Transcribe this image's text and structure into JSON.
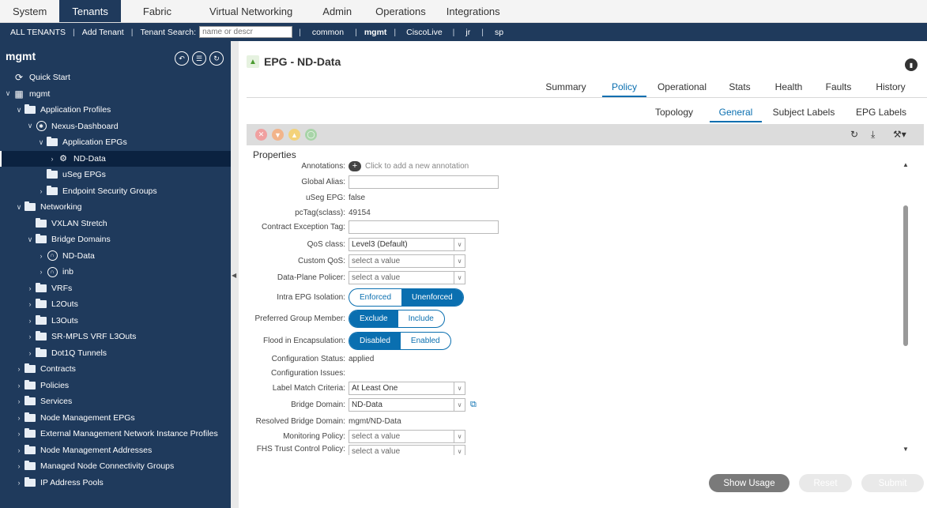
{
  "topnav": {
    "tabs": [
      {
        "label": "System"
      },
      {
        "label": "Tenants"
      },
      {
        "label": "Fabric"
      },
      {
        "label": "Virtual Networking"
      },
      {
        "label": "Admin"
      },
      {
        "label": "Operations"
      },
      {
        "label": "Integrations"
      }
    ],
    "active_tab": "Tenants"
  },
  "subnav": {
    "all_tenants": "ALL TENANTS",
    "add_tenant": "Add Tenant",
    "search_label": "Tenant Search:",
    "search_placeholder": "name or descr",
    "tenants": [
      "common",
      "mgmt",
      "CiscoLive",
      "jr",
      "sp"
    ]
  },
  "sidebar": {
    "title": "mgmt",
    "tree": [
      {
        "label": "Quick Start"
      },
      {
        "label": "mgmt"
      },
      {
        "label": "Application Profiles"
      },
      {
        "label": "Nexus-Dashboard"
      },
      {
        "label": "Application EPGs"
      },
      {
        "label": "ND-Data"
      },
      {
        "label": "uSeg EPGs"
      },
      {
        "label": "Endpoint Security Groups"
      },
      {
        "label": "Networking"
      },
      {
        "label": "VXLAN Stretch"
      },
      {
        "label": "Bridge Domains"
      },
      {
        "label": "ND-Data"
      },
      {
        "label": "inb"
      },
      {
        "label": "VRFs"
      },
      {
        "label": "L2Outs"
      },
      {
        "label": "L3Outs"
      },
      {
        "label": "SR-MPLS VRF L3Outs"
      },
      {
        "label": "Dot1Q Tunnels"
      },
      {
        "label": "Contracts"
      },
      {
        "label": "Policies"
      },
      {
        "label": "Services"
      },
      {
        "label": "Node Management EPGs"
      },
      {
        "label": "External Management Network Instance Profiles"
      },
      {
        "label": "Node Management Addresses"
      },
      {
        "label": "Managed Node Connectivity Groups"
      },
      {
        "label": "IP Address Pools"
      }
    ]
  },
  "main": {
    "title": "EPG - ND-Data",
    "tabs": [
      {
        "label": "Summary"
      },
      {
        "label": "Policy"
      },
      {
        "label": "Operational"
      },
      {
        "label": "Stats"
      },
      {
        "label": "Health"
      },
      {
        "label": "Faults"
      },
      {
        "label": "History"
      }
    ],
    "subtabs": [
      {
        "label": "Topology"
      },
      {
        "label": "General"
      },
      {
        "label": "Subject Labels"
      },
      {
        "label": "EPG Labels"
      }
    ],
    "properties_title": "Properties",
    "form": {
      "annotations_label": "Annotations:",
      "annotations_hint": "Click to add a new annotation",
      "global_alias_label": "Global Alias:",
      "useg_label": "uSeg EPG:",
      "useg_value": "false",
      "pctag_label": "pcTag(sclass):",
      "pctag_value": "49154",
      "contract_tag_label": "Contract Exception Tag:",
      "qos_label": "QoS class:",
      "qos_value": "Level3 (Default)",
      "custom_qos_label": "Custom QoS:",
      "custom_qos_placeholder": "select a value",
      "dpp_label": "Data-Plane Policer:",
      "dpp_placeholder": "select a value",
      "isolation_label": "Intra EPG Isolation:",
      "isolation_options": [
        "Enforced",
        "Unenforced"
      ],
      "pref_label": "Preferred Group Member:",
      "pref_options": [
        "Exclude",
        "Include"
      ],
      "flood_label": "Flood in Encapsulation:",
      "flood_options": [
        "Disabled",
        "Enabled"
      ],
      "config_status_label": "Configuration Status:",
      "config_status_value": "applied",
      "config_issues_label": "Configuration Issues:",
      "label_match_label": "Label Match Criteria:",
      "label_match_value": "At Least One",
      "bd_label": "Bridge Domain:",
      "bd_value": "ND-Data",
      "resolved_bd_label": "Resolved Bridge Domain:",
      "resolved_bd_value": "mgmt/ND-Data",
      "monitoring_label": "Monitoring Policy:",
      "monitoring_placeholder": "select a value",
      "fhs_label": "FHS Trust Control Policy:",
      "fhs_placeholder": "select a value"
    },
    "footer": {
      "show_usage": "Show Usage",
      "reset": "Reset",
      "submit": "Submit"
    }
  }
}
